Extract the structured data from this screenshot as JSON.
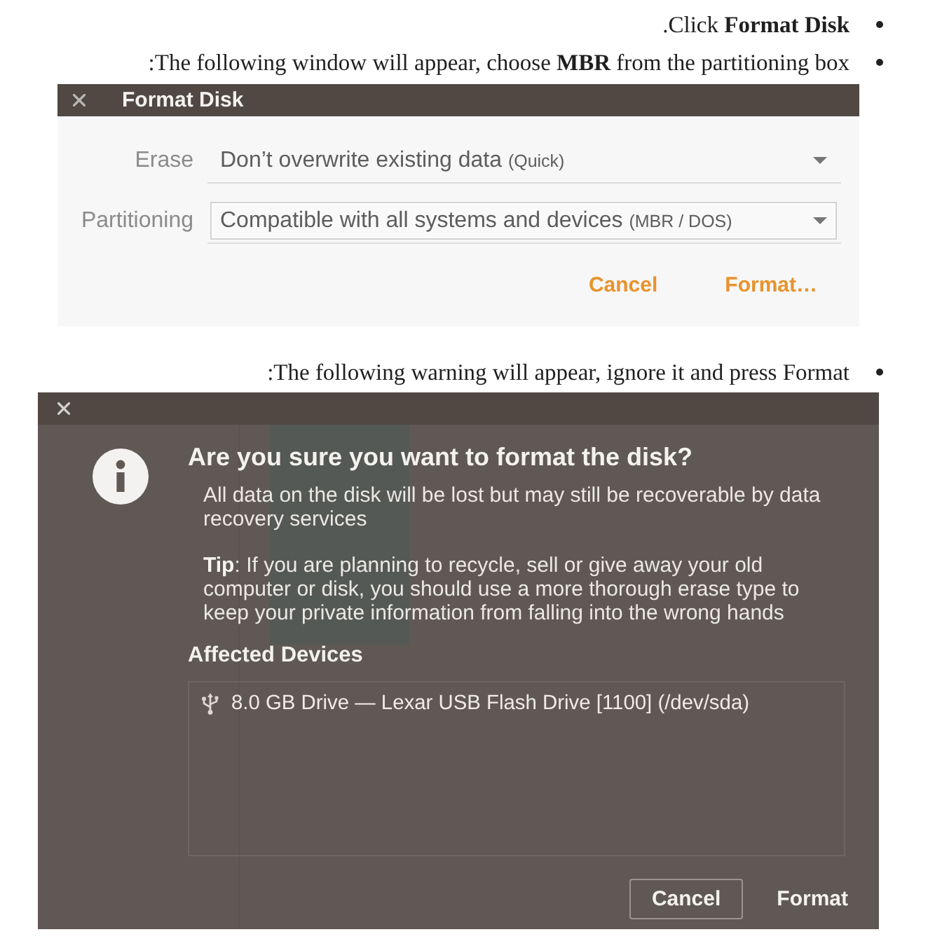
{
  "steps": [
    {
      "text": ".Click **Format Disk**"
    },
    {
      "text": ":The following window will appear, choose **MBR** from the partitioning box",
      "screenshot": {
        "kind": "format_dialog",
        "title": "Format Disk",
        "fields": [
          {
            "label": "Erase",
            "value": "Don’t overwrite existing data",
            "note": "(Quick)",
            "focused": false
          },
          {
            "label": "Partitioning",
            "value": "Compatible with all systems and devices",
            "note": "(MBR / DOS)",
            "focused": true
          }
        ],
        "buttons": [
          "Cancel",
          "Format…"
        ]
      }
    },
    {
      "text": ":The following warning will appear, ignore it and press Format",
      "screenshot": {
        "kind": "confirm_dialog",
        "heading": "Are you sure you want to format the disk?",
        "message": "All data on the disk will be lost but may still be recoverable by data recovery services",
        "tip": "**Tip**: If you are planning to recycle, sell or give away your old computer or disk, you should use a more thorough erase type to keep your private information from falling into the wrong hands",
        "section_title": "Affected Devices",
        "devices": [
          "8.0 GB Drive — Lexar USB Flash Drive [1100] (/dev/sda)"
        ],
        "buttons": [
          {
            "label": "Cancel",
            "focused": true
          },
          {
            "label": "Format",
            "focused": false
          }
        ]
      }
    }
  ]
}
